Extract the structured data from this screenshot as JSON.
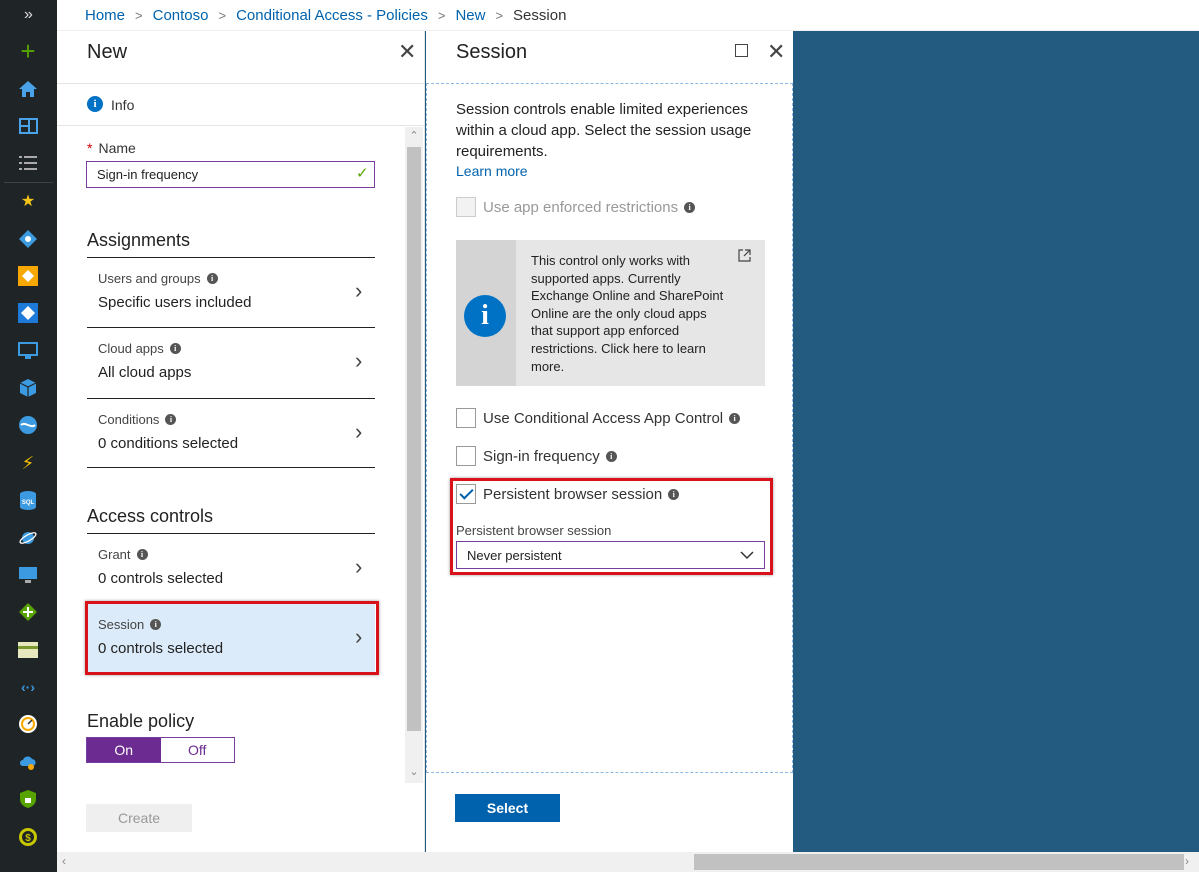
{
  "rail": {
    "expand": "»"
  },
  "breadcrumb": [
    "Home",
    "Contoso",
    "Conditional Access - Policies",
    "New",
    "Session"
  ],
  "new_blade": {
    "title": "New",
    "info_label": "Info",
    "name_label": "Name",
    "name_value": "Sign-in frequency",
    "assignments_heading": "Assignments",
    "assignments": [
      {
        "title": "Users and groups",
        "value": "Specific users included"
      },
      {
        "title": "Cloud apps",
        "value": "All cloud apps"
      },
      {
        "title": "Conditions",
        "value": "0 conditions selected"
      }
    ],
    "access_heading": "Access controls",
    "access": [
      {
        "title": "Grant",
        "value": "0 controls selected"
      },
      {
        "title": "Session",
        "value": "0 controls selected"
      }
    ],
    "enable_heading": "Enable policy",
    "toggle_on": "On",
    "toggle_off": "Off",
    "toggle_selected": "On",
    "create_label": "Create"
  },
  "session_blade": {
    "title": "Session",
    "description": "Session controls enable limited experiences within a cloud app. Select the session usage requirements.",
    "learn_more": "Learn more",
    "app_enforced_label": "Use app enforced restrictions",
    "note_text": "This control only works with supported apps. Currently Exchange Online and SharePoint Online are the only cloud apps that support app enforced restrictions. Click here to learn more.",
    "app_control_label": "Use Conditional Access App Control",
    "signin_freq_label": "Sign-in frequency",
    "persistent_label": "Persistent browser session",
    "persistent_checked": true,
    "dropdown_label": "Persistent browser session",
    "dropdown_value": "Never persistent",
    "select_label": "Select"
  },
  "colors": {
    "accent_blue": "#0062ad",
    "purple": "#6b2b91",
    "highlight_red": "#d9111a",
    "background": "#235a80"
  }
}
